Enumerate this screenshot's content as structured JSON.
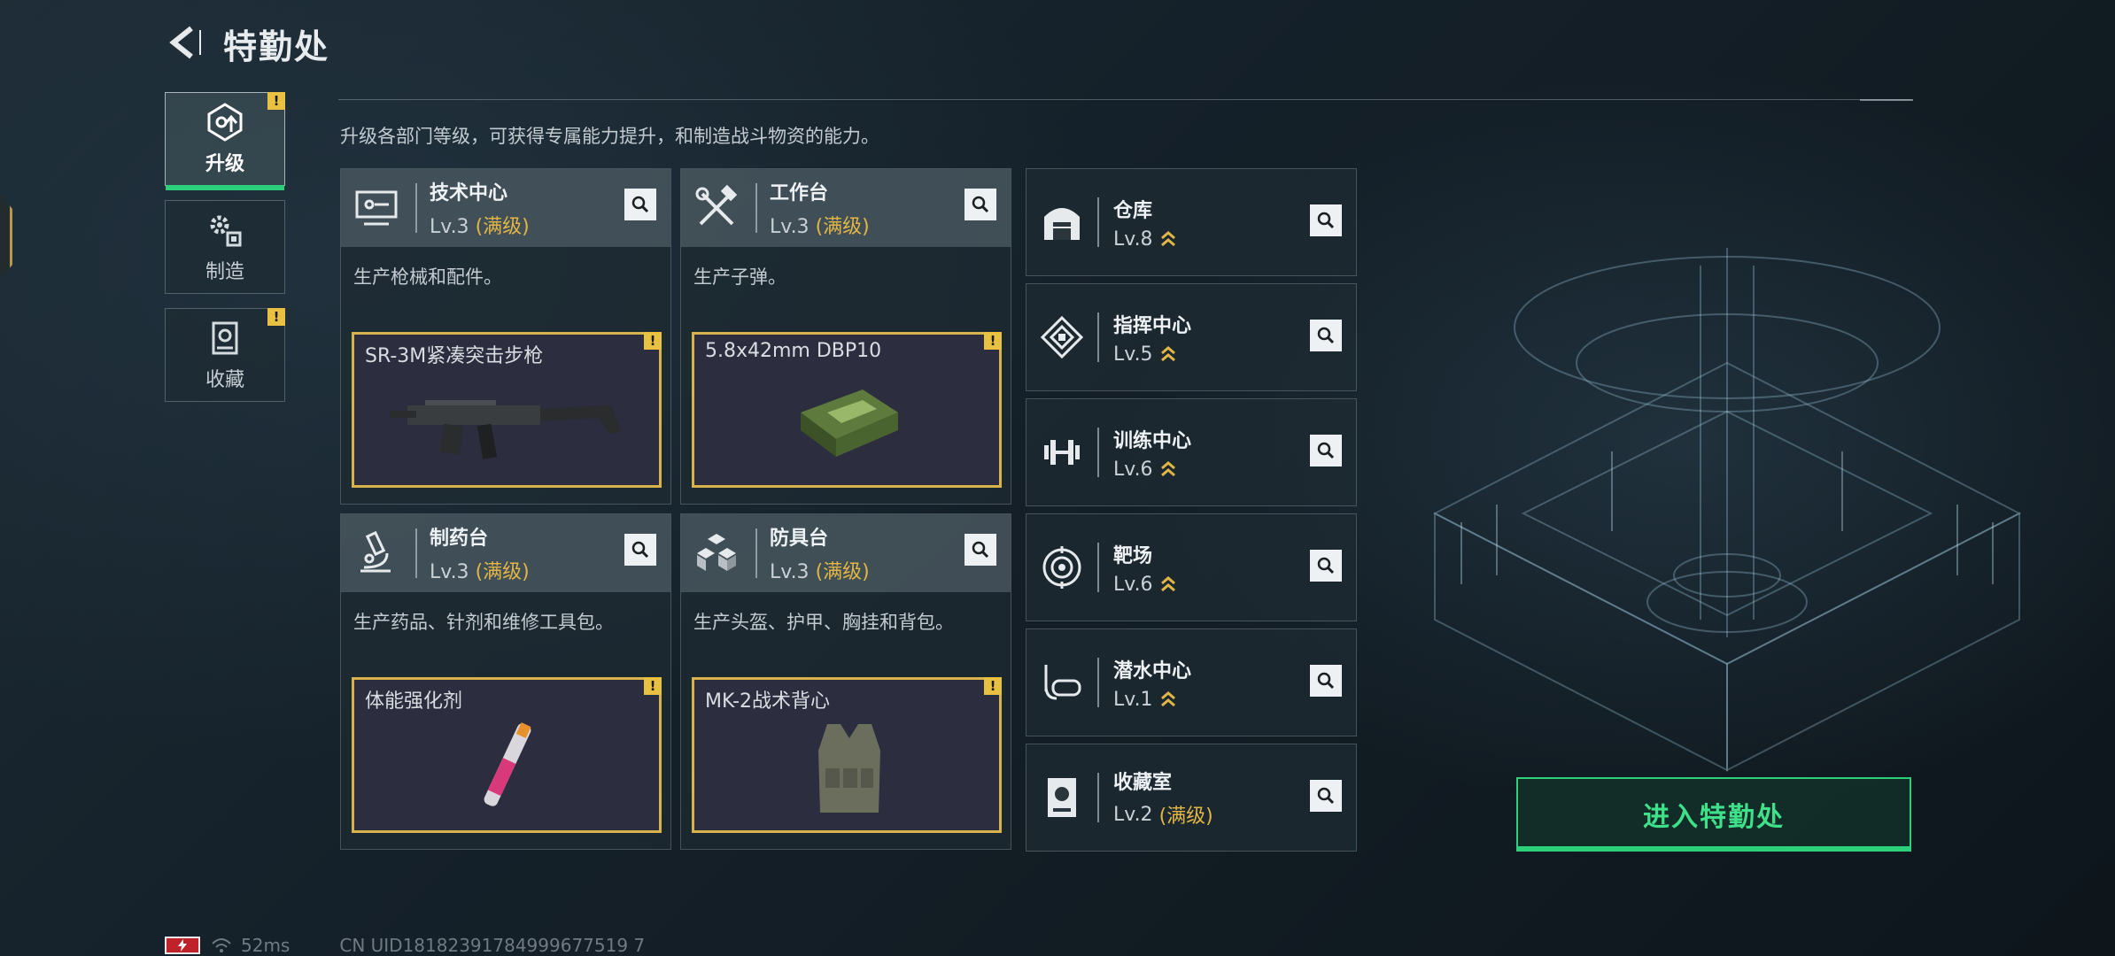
{
  "header": {
    "title": "特勤处"
  },
  "tabs": [
    {
      "label": "升级",
      "icon": "upgrade-icon",
      "badge": "!"
    },
    {
      "label": "制造",
      "icon": "gears-icon",
      "badge": ""
    },
    {
      "label": "收藏",
      "icon": "collection-icon",
      "badge": "!"
    }
  ],
  "description": "升级各部门等级，可获得专属能力提升，和制造战斗物资的能力。",
  "workshops": [
    {
      "name": "技术中心",
      "level": "Lv.3",
      "max": "(满级)",
      "desc": "生产枪械和配件。",
      "item": "SR-3M紧凑突击步枪",
      "icon": "computer-icon"
    },
    {
      "name": "工作台",
      "level": "Lv.3",
      "max": "(满级)",
      "desc": "生产子弹。",
      "item": "5.8x42mm DBP10",
      "icon": "tools-icon"
    },
    {
      "name": "制药台",
      "level": "Lv.3",
      "max": "(满级)",
      "desc": "生产药品、针剂和维修工具包。",
      "item": "体能强化剂",
      "icon": "microscope-icon"
    },
    {
      "name": "防具台",
      "level": "Lv.3",
      "max": "(满级)",
      "desc": "生产头盔、护甲、胸挂和背包。",
      "item": "MK-2战术背心",
      "icon": "armor-blocks-icon"
    }
  ],
  "facilities": [
    {
      "name": "仓库",
      "level": "Lv.8",
      "max": ""
    },
    {
      "name": "指挥中心",
      "level": "Lv.5",
      "max": ""
    },
    {
      "name": "训练中心",
      "level": "Lv.6",
      "max": ""
    },
    {
      "name": "靶场",
      "level": "Lv.6",
      "max": ""
    },
    {
      "name": "潜水中心",
      "level": "Lv.1",
      "max": ""
    },
    {
      "name": "收藏室",
      "level": "Lv.2",
      "max": "(满级)"
    }
  ],
  "enter_button": "进入特勤处",
  "footer": {
    "ping": "52ms",
    "uid": "CN UID18182391784999677519 7"
  },
  "colors": {
    "accent_green": "#2bd07a",
    "gold": "#e2b646",
    "badge_yellow": "#e8c042"
  }
}
